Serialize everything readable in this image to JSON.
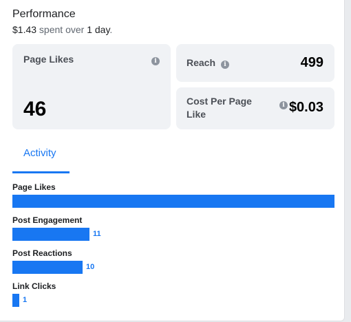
{
  "performance": {
    "title": "Performance",
    "spent_amount": "$1.43",
    "spent_mid": " spent over ",
    "duration": "1 day",
    "spent_end": "."
  },
  "metrics": {
    "page_likes": {
      "label": "Page Likes",
      "value": "46"
    },
    "reach": {
      "label": "Reach",
      "value": "499"
    },
    "cost_per_like": {
      "label": "Cost Per Page Like",
      "value": "$0.03"
    }
  },
  "info_icon_glyph": "i",
  "tabs": [
    {
      "label": "Activity",
      "active": true
    }
  ],
  "activity": [
    {
      "label": "Page Likes",
      "value": 46,
      "value_label": ""
    },
    {
      "label": "Post Engagement",
      "value": 11,
      "value_label": "11"
    },
    {
      "label": "Post Reactions",
      "value": 10,
      "value_label": "10"
    },
    {
      "label": "Link Clicks",
      "value": 1,
      "value_label": "1"
    }
  ],
  "colors": {
    "accent": "#1877f2",
    "tile_bg": "#f0f2f5",
    "icon": "#8d949e"
  }
}
